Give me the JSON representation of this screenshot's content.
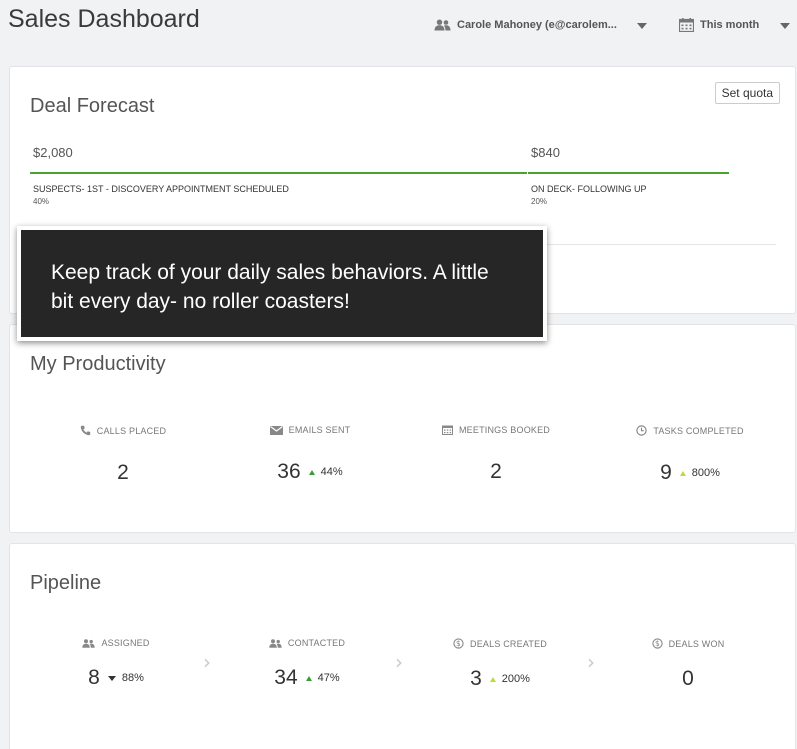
{
  "header": {
    "title": "Sales Dashboard",
    "user_label": "Carole Mahoney (e@carolem...",
    "period_label": "This month"
  },
  "forecast": {
    "title": "Deal Forecast",
    "set_quota_label": "Set quota",
    "segments": [
      {
        "amount": "$2,080",
        "stage": "SUSPECTS- 1ST - DISCOVERY APPOINTMENT SCHEDULED",
        "percent": "40%"
      },
      {
        "amount": "$840",
        "stage": "ON DECK- FOLLOWING UP",
        "percent": "20%"
      }
    ]
  },
  "productivity": {
    "title": "My Productivity",
    "metrics": [
      {
        "label": "CALLS PLACED",
        "icon": "phone-icon",
        "value": "2",
        "delta": ""
      },
      {
        "label": "EMAILS SENT",
        "icon": "envelope-icon",
        "value": "36",
        "delta": "44%"
      },
      {
        "label": "MEETINGS BOOKED",
        "icon": "calendar-icon",
        "value": "2",
        "delta": ""
      },
      {
        "label": "TASKS COMPLETED",
        "icon": "clock-icon",
        "value": "9",
        "delta": "800%"
      }
    ]
  },
  "pipeline": {
    "title": "Pipeline",
    "stages": [
      {
        "label": "ASSIGNED",
        "icon": "users-icon",
        "value": "8",
        "delta": "88%"
      },
      {
        "label": "CONTACTED",
        "icon": "users-icon",
        "value": "34",
        "delta": "47%"
      },
      {
        "label": "DEALS CREATED",
        "icon": "dollar-circle-icon",
        "value": "3",
        "delta": "200%"
      },
      {
        "label": "DEALS WON",
        "icon": "dollar-circle-icon",
        "value": "0",
        "delta": ""
      }
    ]
  },
  "tooltip": {
    "text": "Keep track of your daily sales behaviors. A little bit every day- no roller coasters!"
  },
  "colors": {
    "accent_green": "#4aa32f",
    "delta_up_green": "#3a9e33",
    "delta_up_lime": "#b6df37",
    "tooltip_bg": "#262626"
  }
}
